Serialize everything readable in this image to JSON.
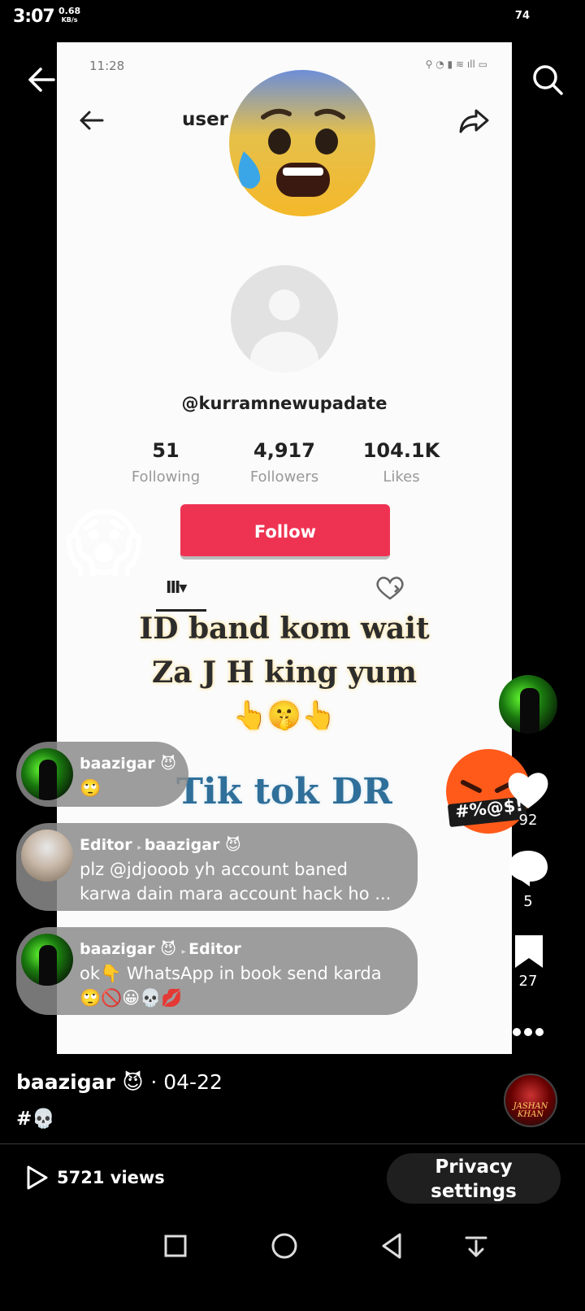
{
  "status_bar": {
    "time": "3:07",
    "net_speed": "0.68",
    "net_unit": "KB/s",
    "battery": "74"
  },
  "video": {
    "status_time": "11:28",
    "profile_username": "user",
    "profile_handle": "@kurramnewupadate",
    "stats": [
      {
        "value": "51",
        "label": "Following"
      },
      {
        "value": "4,917",
        "label": "Followers"
      },
      {
        "value": "104.1K",
        "label": "Likes"
      }
    ],
    "follow_label": "Follow",
    "overlay_lines": [
      "ID band kom wait",
      "Za J H king yum",
      "👆🤫👆"
    ],
    "overlay_bottom": "Tik tok DR"
  },
  "comments": [
    {
      "author": "baazigar 😈",
      "reply_to": "",
      "text_lines": [
        "🙄"
      ]
    },
    {
      "author": "Editor",
      "reply_to": "baazigar 😈",
      "text_lines": [
        "plz @jdjooob yh account baned",
        "karwa dain mara account hack ho ..."
      ]
    },
    {
      "author": "baazigar 😈",
      "reply_to": "Editor",
      "text_lines": [
        "ok👇 WhatsApp in book send karda",
        "🙄🚫😀💀💋"
      ]
    }
  ],
  "rail": {
    "likes": "92",
    "comments": "5",
    "saves": "27",
    "angry_caption": "#%@$!"
  },
  "post": {
    "author": "baazigar 😈",
    "date": "· 04-22",
    "hashtag": "#💀",
    "music_label": "JASHAN KHAN"
  },
  "footer": {
    "views": "5721 views",
    "privacy_line1": "Privacy",
    "privacy_line2": "settings"
  }
}
